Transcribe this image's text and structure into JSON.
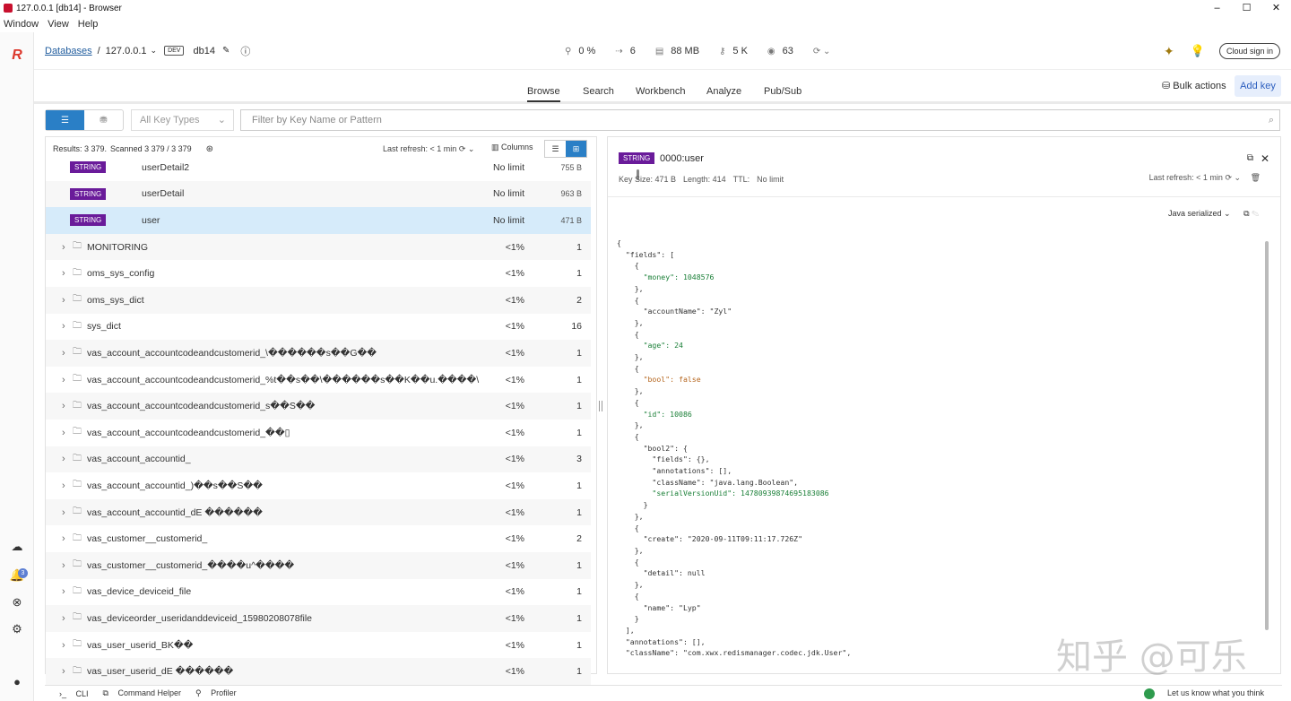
{
  "window": {
    "title": "127.0.0.1 [db14] - Browser",
    "controls": [
      "–",
      "☐",
      "✕"
    ]
  },
  "menu": [
    "Window",
    "View",
    "Help"
  ],
  "breadcrumb": {
    "databases": "Databases",
    "separator": "/",
    "host": "127.0.0.1",
    "env": "DEV",
    "db": "db14"
  },
  "stats": {
    "cpu": "0 %",
    "connections": "6",
    "memory": "88 MB",
    "keys": "5 K",
    "clients": "63"
  },
  "topright": {
    "cloud": "Cloud sign in"
  },
  "tabs": [
    "Browse",
    "Search",
    "Workbench",
    "Analyze",
    "Pub/Sub"
  ],
  "actions": {
    "bulk": "Bulk actions",
    "add": "Add key"
  },
  "filter": {
    "key_types": "All Key Types",
    "placeholder": "Filter by Key Name or Pattern"
  },
  "list": {
    "results": "Results: 3 379.",
    "scanned": "Scanned 3 379 / 3 379",
    "last_refresh": "Last refresh:  < 1 min",
    "columns": "Columns",
    "keys": [
      {
        "type": "STRING",
        "name": "userDetail2",
        "ttl": "No limit",
        "size": "755 B"
      },
      {
        "type": "STRING",
        "name": "userDetail",
        "ttl": "No limit",
        "size": "963 B"
      },
      {
        "type": "STRING",
        "name": "user",
        "ttl": "No limit",
        "size": "471 B"
      }
    ],
    "folders": [
      {
        "name": "MONITORING",
        "pct": "<1%",
        "count": "1"
      },
      {
        "name": "oms_sys_config",
        "pct": "<1%",
        "count": "1"
      },
      {
        "name": "oms_sys_dict",
        "pct": "<1%",
        "count": "2"
      },
      {
        "name": "sys_dict",
        "pct": "<1%",
        "count": "16"
      },
      {
        "name": "vas_account_accountcodeandcustomerid_\\������s��G��",
        "pct": "<1%",
        "count": "1"
      },
      {
        "name": "vas_account_accountcodeandcustomerid_%t��s��\\������s��K��u.����\\",
        "pct": "<1%",
        "count": "1"
      },
      {
        "name": "vas_account_accountcodeandcustomerid_s��S��",
        "pct": "<1%",
        "count": "1"
      },
      {
        "name": "vas_account_accountcodeandcustomerid_��▯",
        "pct": "<1%",
        "count": "1"
      },
      {
        "name": "vas_account_accountid_",
        "pct": "<1%",
        "count": "3"
      },
      {
        "name": "vas_account_accountid_)��s��S��",
        "pct": "<1%",
        "count": "1"
      },
      {
        "name": "vas_account_accountid_dE ������",
        "pct": "<1%",
        "count": "1"
      },
      {
        "name": "vas_customer__customerid_",
        "pct": "<1%",
        "count": "2"
      },
      {
        "name": "vas_customer__customerid_����u^����",
        "pct": "<1%",
        "count": "1"
      },
      {
        "name": "vas_device_deviceid_file",
        "pct": "<1%",
        "count": "1"
      },
      {
        "name": "vas_deviceorder_useridanddeviceid_15980208078file",
        "pct": "<1%",
        "count": "1"
      },
      {
        "name": "vas_user_userid_BK��",
        "pct": "<1%",
        "count": "1"
      },
      {
        "name": "vas_user_userid_dE ������",
        "pct": "<1%",
        "count": "1"
      }
    ]
  },
  "detail": {
    "type": "STRING",
    "key": "0000:user",
    "key_size": "Key Size: 471 B",
    "length": "Length: 414",
    "ttl_label": "TTL:",
    "ttl": "No limit",
    "last_refresh": "Last refresh:  < 1 min",
    "format": "Java serialized",
    "json_lines": [
      "{",
      "  \"fields\": [",
      "    {",
      "      \"money\": 1048576",
      "    },",
      "    {",
      "      \"accountName\": \"Zyl\"",
      "    },",
      "    {",
      "      \"age\": 24",
      "    },",
      "    {",
      "      \"bool\": false",
      "    },",
      "    {",
      "      \"id\": 10086",
      "    },",
      "    {",
      "      \"bool2\": {",
      "        \"fields\": {},",
      "        \"annotations\": [],",
      "        \"className\": \"java.lang.Boolean\",",
      "        \"serialVersionUid\": 14780939874695183086",
      "      }",
      "    },",
      "    {",
      "      \"create\": \"2020-09-11T09:11:17.726Z\"",
      "    },",
      "    {",
      "      \"detail\": null",
      "    },",
      "    {",
      "      \"name\": \"Lyp\"",
      "    }",
      "  ],",
      "  \"annotations\": [],",
      "  \"className\": \"com.xwx.redismanager.codec.jdk.User\","
    ]
  },
  "watermark": "知乎 @可乐",
  "bottom": {
    "cli": "CLI",
    "helper": "Command Helper",
    "profiler": "Profiler",
    "feedback": "Let us know what you think",
    "bell_count": "3"
  },
  "colors": {
    "accent": "#2a7fc6",
    "string_badge": "#6a1b9a",
    "selected_row": "#d6ebfa",
    "brand": "#dc382c"
  }
}
